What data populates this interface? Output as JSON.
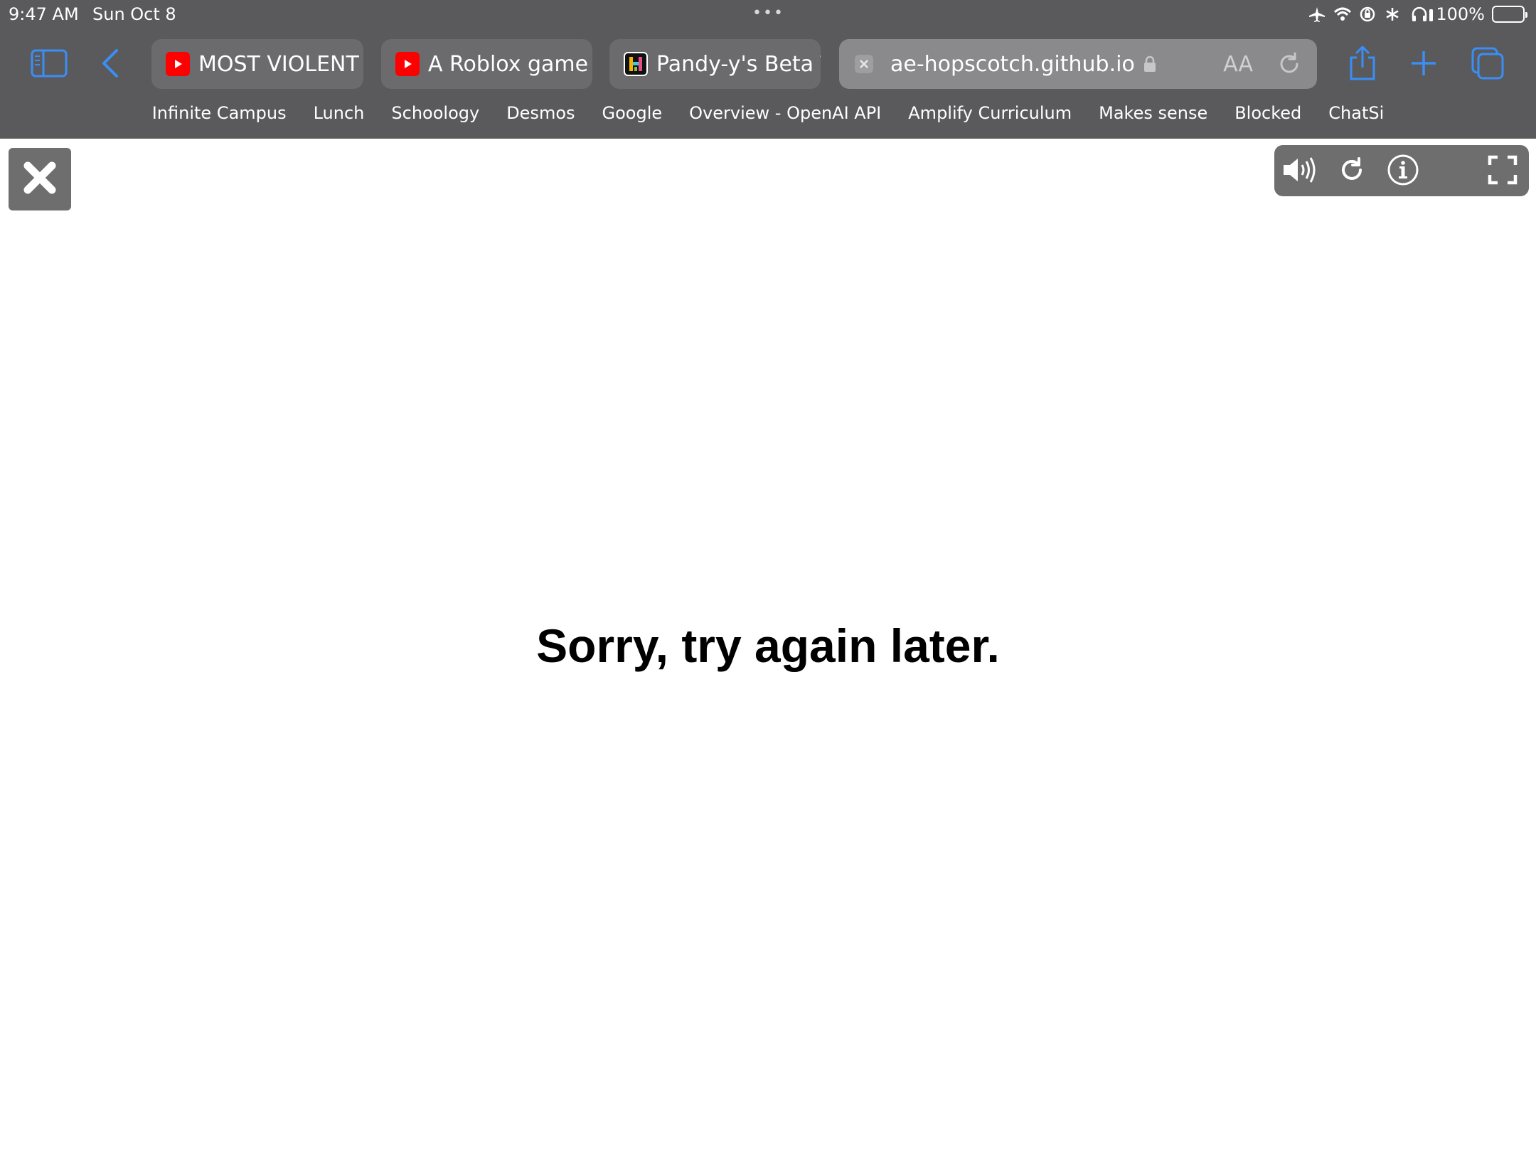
{
  "status_bar": {
    "time": "9:47 AM",
    "date": "Sun Oct 8",
    "dots": "•••",
    "battery_percent": "100%",
    "battery_level": 1.0,
    "icons": [
      "airplane-icon",
      "wifi-icon",
      "orientation-lock-icon",
      "snowflake-icon",
      "headphones-icon"
    ]
  },
  "toolbar": {
    "sidebar_icon": "sidebar-icon",
    "back_icon": "chevron-left-icon",
    "share_icon": "share-icon",
    "new_tab_icon": "plus-icon",
    "tabs_overview_icon": "tabs-icon",
    "accent_color": "#3a8ef6"
  },
  "tabs": [
    {
      "title": "MOST VIOLENT",
      "favicon": "youtube-icon"
    },
    {
      "title": "A Roblox game a",
      "favicon": "youtube-icon"
    },
    {
      "title": "Pandy-y's Beta T",
      "favicon": "hopscotch-icon"
    }
  ],
  "address_bar": {
    "url": "ae-hopscotch.github.io",
    "reader_label": "AA",
    "lock_icon": "lock-icon",
    "reload_icon": "reload-icon",
    "favicon": "blank-favicon-icon"
  },
  "bookmarks": [
    "Infinite Campus",
    "Lunch",
    "Schoology",
    "Desmos",
    "Google",
    "Overview - OpenAI API",
    "Amplify Curriculum",
    "Makes sense",
    "Blocked",
    "ChatSi"
  ],
  "page": {
    "message": "Sorry, try again later.",
    "close_icon": "close-x-icon",
    "controls": [
      "volume-icon",
      "restart-icon",
      "info-icon",
      "fullscreen-icon"
    ]
  }
}
